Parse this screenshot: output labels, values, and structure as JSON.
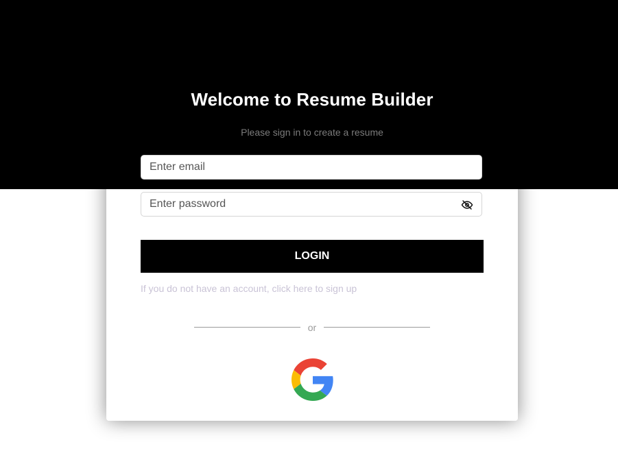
{
  "login_card": {
    "title": "Welcome to Resume Builder",
    "subtitle": "Please sign in to create a resume",
    "email_field": {
      "value": "",
      "placeholder": "Enter email"
    },
    "password_field": {
      "value": "",
      "placeholder": "Enter password",
      "toggle_icon": "eye-slash-icon"
    },
    "login_button_label": "LOGIN",
    "signup_link_text": "If you do not have an account, click here to sign up",
    "divider_text": "or",
    "google_icon": "google-icon"
  },
  "colors": {
    "background_top": "#000000",
    "background_bottom": "#ffffff",
    "button_background": "#000000",
    "button_text": "#ffffff",
    "signup_link": "#c9c3d6",
    "google_red": "#EA4335",
    "google_yellow": "#FBBC05",
    "google_green": "#34A853",
    "google_blue": "#4285F4"
  }
}
